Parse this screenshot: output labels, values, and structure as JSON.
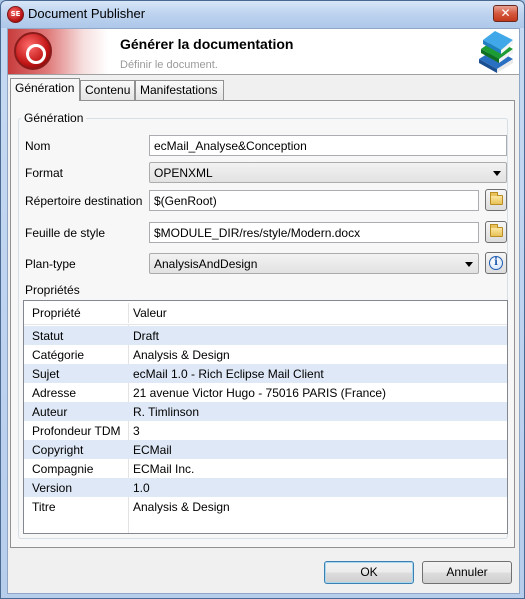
{
  "window": {
    "title": "Document Publisher",
    "app_icon_text": "SE",
    "close_glyph": "✕"
  },
  "banner": {
    "title": "Générer la documentation",
    "subtitle": "Définir le document.",
    "logo_icon": "modelio-logo-icon",
    "illustration_icon": "books-icon"
  },
  "tabs": [
    {
      "label": "Génération",
      "active": true
    },
    {
      "label": "Contenu",
      "active": false
    },
    {
      "label": "Manifestations",
      "active": false
    }
  ],
  "group": {
    "legend": "Génération",
    "name_label": "Nom",
    "name_value": "ecMail_Analyse&Conception",
    "format_label": "Format",
    "format_value": "OPENXML",
    "dest_label": "Répertoire destination",
    "dest_value": "$(GenRoot)",
    "style_label": "Feuille de style",
    "style_value": "$MODULE_DIR/res/style/Modern.docx",
    "plan_label": "Plan-type",
    "plan_value": "AnalysisAndDesign",
    "props_label": "Propriétés"
  },
  "properties": {
    "headers": [
      "Propriété",
      "Valeur"
    ],
    "rows": [
      [
        "Statut",
        "Draft"
      ],
      [
        "Catégorie",
        "Analysis & Design"
      ],
      [
        "Sujet",
        "ecMail 1.0 - Rich Eclipse Mail Client"
      ],
      [
        "Adresse",
        "21 avenue Victor Hugo - 75016 PARIS (France)"
      ],
      [
        "Auteur",
        "R. Timlinson"
      ],
      [
        "Profondeur TDM",
        "3"
      ],
      [
        "Copyright",
        "ECMail"
      ],
      [
        "Compagnie",
        "ECMail Inc."
      ],
      [
        "Version",
        "1.0"
      ],
      [
        "Titre",
        "Analysis & Design"
      ]
    ]
  },
  "buttons": {
    "ok": "OK",
    "cancel": "Annuler"
  }
}
